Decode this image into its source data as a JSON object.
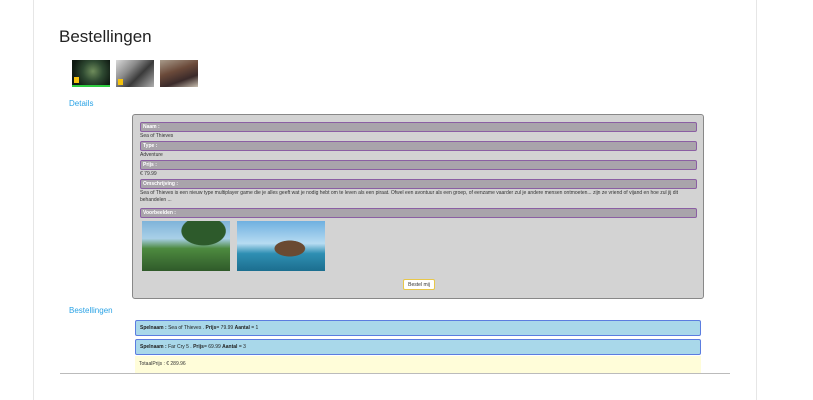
{
  "page": {
    "title": "Bestellingen"
  },
  "thumbnails": [
    {
      "name": "Sea of Thieves",
      "selected": true
    },
    {
      "name": "Far Cry 5",
      "selected": false
    },
    {
      "name": "game-3",
      "selected": false
    }
  ],
  "links": {
    "details": "Details",
    "orders": "Bestellingen"
  },
  "details": {
    "name_label": "Naam :",
    "name_value": "Sea of Thieves",
    "type_label": "Type :",
    "type_value": "Adventure",
    "price_label": "Prijs :",
    "price_value": "€ 79.99",
    "description_label": "Omschrijving :",
    "description_value": "Sea of Thieves is een nieuw type multiplayer game die je alles geeft wat je nodig hebt om te leven als een piraat. Ofwel een avontuur als een groep, of eenzame vaarder zul je andere mensen ontmoeten... zijn ze vriend of vijand en hoe zul jij dit behandelen ...",
    "examples_label": "Voorbeelden :",
    "buy_button": "Bestel mij"
  },
  "orders": [
    {
      "game_label": "Spelnaam :",
      "game": "Sea of Thieves",
      "price_label": "Prijs",
      "price": "= 79.99",
      "qty_label": "Aantal",
      "qty": "= 1"
    },
    {
      "game_label": "Spelnaam :",
      "game": "Far Cry 5",
      "price_label": "Prijs",
      "price": "= 69.99",
      "qty_label": "Aantal",
      "qty": "= 3"
    }
  ],
  "total": {
    "text": "TotaalPrijs : € 289.96"
  },
  "colors": {
    "accent_link": "#2aa3e6",
    "label_border": "#8b5fa3",
    "order_row_bg": "#a9d8ea",
    "total_bg": "#fffdd9",
    "button_border": "#e8c74a"
  }
}
